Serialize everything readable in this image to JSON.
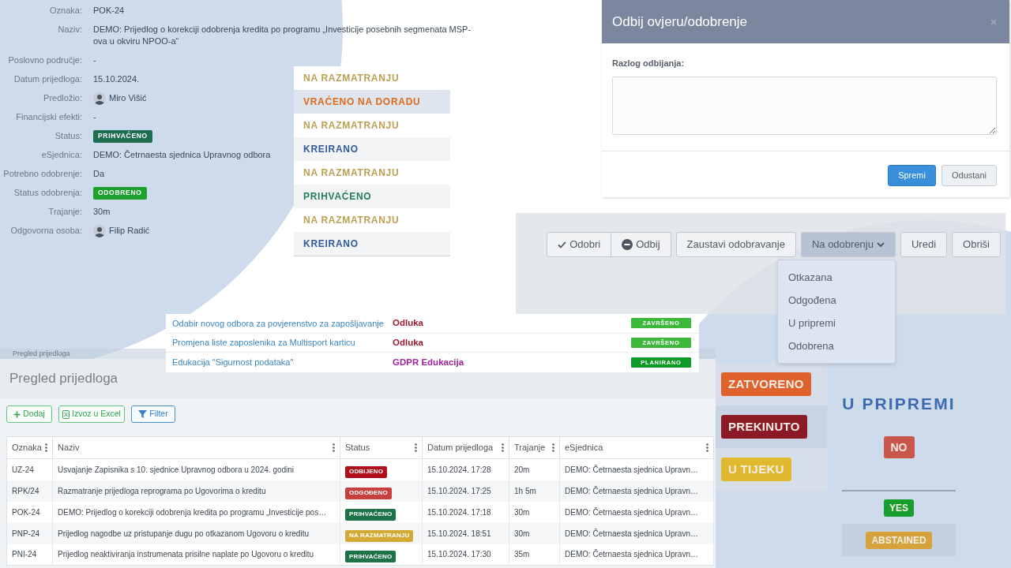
{
  "proposal_details": {
    "fields": [
      {
        "label": "Oznaka:",
        "kind": "text",
        "value": "POK-24"
      },
      {
        "label": "Naziv:",
        "kind": "text",
        "value": "DEMO: Prijedlog o korekciji odobrenja kredita po programu „Investicije posebnih segmenata MSP-ova u okviru NPOO-a“"
      },
      {
        "label": "Poslovno područje:",
        "kind": "text",
        "value": "-"
      },
      {
        "label": "Datum prijedloga:",
        "kind": "text",
        "value": "15.10.2024."
      },
      {
        "label": "Predložio:",
        "kind": "person",
        "value": "Miro Višić"
      },
      {
        "label": "Financijski efekti:",
        "kind": "text",
        "value": "-"
      },
      {
        "label": "Status:",
        "kind": "badge",
        "value": "PRIHVAĆENO",
        "color": "#1f6e52"
      },
      {
        "label": "eSjednica:",
        "kind": "text",
        "value": "DEMO: Četrnaesta sjednica Upravnog odbora"
      },
      {
        "label": "Potrebno odobrenje:",
        "kind": "text",
        "value": "Da"
      },
      {
        "label": "Status odobrenja:",
        "kind": "badge",
        "value": "ODOBRENO",
        "color": "#1fa12e"
      },
      {
        "label": "Trajanje:",
        "kind": "text",
        "value": "30m"
      },
      {
        "label": "Odgovorna osoba:",
        "kind": "person",
        "value": "Filip Radić"
      }
    ]
  },
  "status_list": {
    "items": [
      {
        "label": "NA RAZMATRANJU",
        "color": "#bba050",
        "selected": false
      },
      {
        "label": "VRAĆENO NA DORADU",
        "color": "#e06a1c",
        "selected": true
      },
      {
        "label": "NA RAZMATRANJU",
        "color": "#bba050",
        "selected": false
      },
      {
        "label": "KREIRANO",
        "color": "#30599e",
        "selected": false
      },
      {
        "label": "NA RAZMATRANJU",
        "color": "#bba050",
        "selected": false
      },
      {
        "label": "PRIHVAĆENO",
        "color": "#24795a",
        "selected": false
      },
      {
        "label": "NA RAZMATRANJU",
        "color": "#bba050",
        "selected": false
      },
      {
        "label": "KREIRANO",
        "color": "#30599e",
        "selected": false
      }
    ]
  },
  "reject_dialog": {
    "title": "Odbij ovjeru/odobrenje",
    "field_label": "Razlog odbijanja:",
    "buttons": [
      {
        "label": "Spremi",
        "kind": "primary"
      },
      {
        "label": "Odustani",
        "kind": "secondary"
      }
    ]
  },
  "approval_toolbar": {
    "groups": [
      {
        "buttons": [
          {
            "label": "Odobri",
            "kind": "approve"
          },
          {
            "label": "Odbij",
            "kind": "reject"
          }
        ]
      },
      {
        "buttons": [
          {
            "label": "Zaustavi odobravanje",
            "kind": "plain"
          }
        ]
      },
      {
        "buttons": [
          {
            "label": "Na odobrenju",
            "kind": "dropdown",
            "expanded": true,
            "menu": [
              "Otkazana",
              "Odgođena",
              "U pripremi",
              "Odobrena"
            ]
          }
        ]
      },
      {
        "buttons": [
          {
            "label": "Uredi",
            "kind": "plain"
          }
        ]
      },
      {
        "buttons": [
          {
            "label": "Obriši",
            "kind": "plain"
          }
        ]
      }
    ]
  },
  "activity_list": {
    "rows": [
      {
        "title": "Odabir novog odbora za povjerenstvo za zapošljavanje",
        "type": {
          "text": "Odluka",
          "color": "#9b1b32"
        },
        "status": {
          "text": "ZAVRŠENO",
          "color": "#3db83a"
        }
      },
      {
        "title": "Promjena liste zaposlenika za Multisport karticu",
        "type": {
          "text": "Odluka",
          "color": "#9b1b32"
        },
        "status": {
          "text": "ZAVRŠENO",
          "color": "#3db83a"
        }
      },
      {
        "title": "Edukacija \"Sigurnost podataka\"",
        "type": {
          "text": "GDPR Edukacija",
          "color": "#a3229e"
        },
        "status": {
          "text": "PLANIRANO",
          "color": "#0f9a27"
        }
      }
    ]
  },
  "proposals_view": {
    "breadcrumb": "Pregled prijedloga",
    "title": "Pregled prijedloga",
    "actions": [
      {
        "label": "Dodaj",
        "kind": "add"
      },
      {
        "label": "Izvoz u Excel",
        "kind": "export"
      },
      {
        "label": "Filter",
        "kind": "filter"
      }
    ],
    "table": {
      "columns": [
        "Oznaka",
        "Naziv",
        "Status",
        "Datum prijedloga",
        "Trajanje",
        "eSjednica"
      ],
      "rows": [
        {
          "code": "UZ-24",
          "title": "Usvajanje Zapisnika s 10. sjednice Upravnog odbora u 2024. godini",
          "status": {
            "text": "ODBIJENO",
            "color": "#b0101c"
          },
          "date": "15.10.2024. 17:28",
          "duration": "20m",
          "session": "DEMO: Četrnaesta sjednica Upravn…"
        },
        {
          "code": "RPK/24",
          "title": "Razmatranje prijedloga reprograma po Ugovorima o kreditu",
          "status": {
            "text": "ODGOĐENO",
            "color": "#c8403e"
          },
          "date": "15.10.2024. 17:25",
          "duration": "1h 5m",
          "session": "DEMO: Četrnaesta sjednica Upravn…"
        },
        {
          "code": "POK-24",
          "title": "DEMO: Prijedlog o korekciji odobrenja kredita po programu „Investicije pos…",
          "status": {
            "text": "PRIHVAĆENO",
            "color": "#1d7347"
          },
          "date": "15.10.2024. 17:18",
          "duration": "30m",
          "session": "DEMO: Četrnaesta sjednica Upravn…"
        },
        {
          "code": "PNP-24",
          "title": "Prijedlog nagodbe uz pristupanje dugu po otkazanom Ugovoru o kreditu",
          "status": {
            "text": "NA RAZMATRANJU",
            "color": "#d3aa35"
          },
          "date": "15.10.2024. 18:51",
          "duration": "30m",
          "session": "DEMO: Četrnaesta sjednica Upravn…"
        },
        {
          "code": "PNI-24",
          "title": "Prijedlog neaktiviranja instrumenata prisilne naplate po Ugovoru o kreditu",
          "status": {
            "text": "PRIHVAĆENO",
            "color": "#1d7347"
          },
          "date": "15.10.2024. 17:30",
          "duration": "35m",
          "session": "DEMO: Četrnaesta sjednica Upravn…"
        }
      ]
    }
  },
  "status_badges": {
    "items": [
      {
        "label": "ZATVORENO",
        "color": "#df612c"
      },
      {
        "label": "PREKINUTO",
        "color": "#8c1a24"
      },
      {
        "label": "U TIJEKU",
        "color": "#e1b92f"
      }
    ]
  },
  "vote_panel": {
    "heading": "U PRIPREMI",
    "result": {
      "label": "NO",
      "color": "#c9564a"
    },
    "votes": [
      {
        "label": "YES",
        "color": "#179e2c"
      },
      {
        "label": "ABSTAINED",
        "color": "#d6a23e"
      }
    ]
  }
}
